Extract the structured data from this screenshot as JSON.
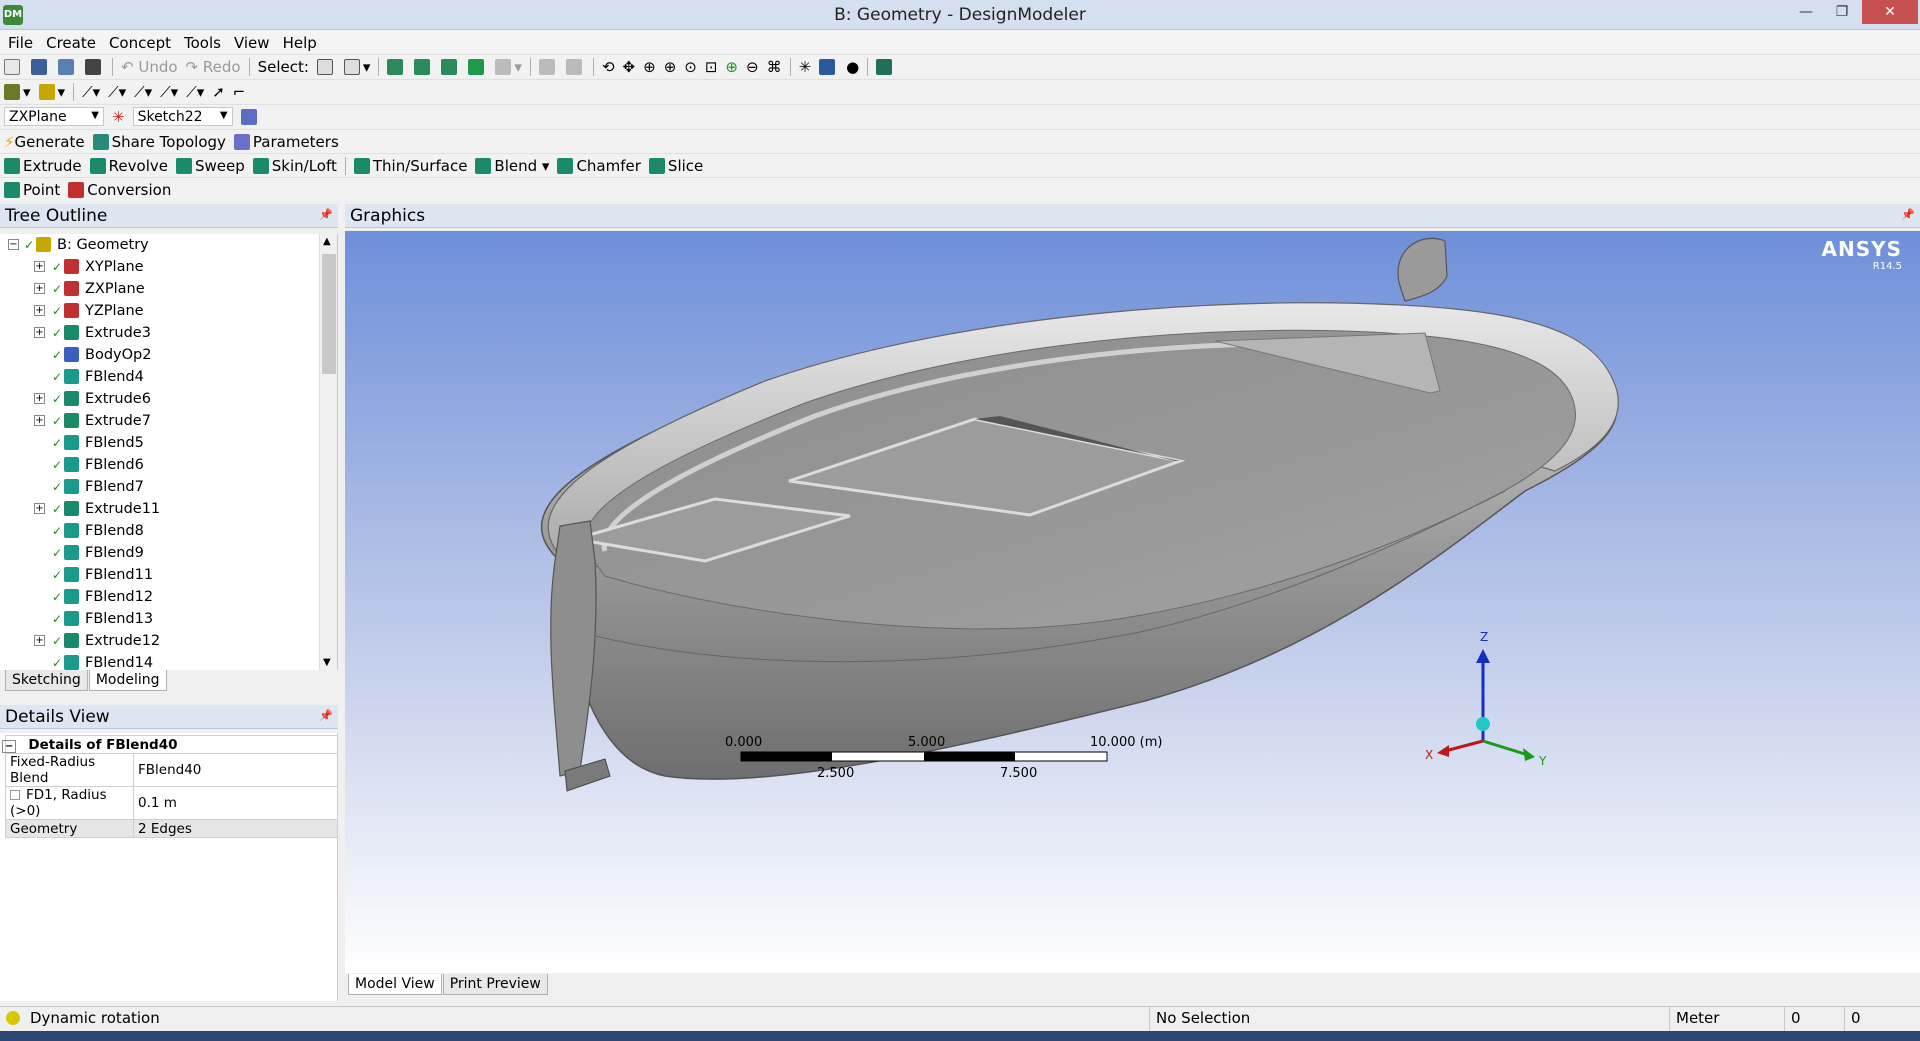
{
  "window": {
    "app_icon": "DM",
    "title": "B: Geometry - DesignModeler",
    "min_glyph": "—",
    "max_glyph": "❐",
    "close_glyph": "✕"
  },
  "menu": [
    "File",
    "Create",
    "Concept",
    "Tools",
    "View",
    "Help"
  ],
  "toolbar1": {
    "undo": "Undo",
    "redo": "Redo",
    "select_label": "Select:"
  },
  "toolbar3": {
    "plane_value": "ZXPlane",
    "sketch_value": "Sketch22"
  },
  "toolbar4": {
    "generate": "Generate",
    "share_topology": "Share Topology",
    "parameters": "Parameters"
  },
  "toolbar5": {
    "extrude": "Extrude",
    "revolve": "Revolve",
    "sweep": "Sweep",
    "skin_loft": "Skin/Loft",
    "thin_surface": "Thin/Surface",
    "blend": "Blend",
    "chamfer": "Chamfer",
    "slice": "Slice"
  },
  "toolbar6": {
    "point": "Point",
    "conversion": "Conversion"
  },
  "tree_outline": {
    "title": "Tree Outline",
    "root": "B: Geometry",
    "items": [
      {
        "label": "XYPlane",
        "icon": "plane-icon",
        "expandable": true
      },
      {
        "label": "ZXPlane",
        "icon": "plane-icon",
        "expandable": true
      },
      {
        "label": "YZPlane",
        "icon": "plane-icon",
        "expandable": true
      },
      {
        "label": "Extrude3",
        "icon": "extrude-icon",
        "expandable": true
      },
      {
        "label": "BodyOp2",
        "icon": "bodyop-icon",
        "expandable": false
      },
      {
        "label": "FBlend4",
        "icon": "blend-icon",
        "expandable": false
      },
      {
        "label": "Extrude6",
        "icon": "extrude-icon",
        "expandable": true
      },
      {
        "label": "Extrude7",
        "icon": "extrude-icon",
        "expandable": true
      },
      {
        "label": "FBlend5",
        "icon": "blend-icon",
        "expandable": false
      },
      {
        "label": "FBlend6",
        "icon": "blend-icon",
        "expandable": false
      },
      {
        "label": "FBlend7",
        "icon": "blend-icon",
        "expandable": false
      },
      {
        "label": "Extrude11",
        "icon": "extrude-icon",
        "expandable": true
      },
      {
        "label": "FBlend8",
        "icon": "blend-icon",
        "expandable": false
      },
      {
        "label": "FBlend9",
        "icon": "blend-icon",
        "expandable": false
      },
      {
        "label": "FBlend11",
        "icon": "blend-icon",
        "expandable": false
      },
      {
        "label": "FBlend12",
        "icon": "blend-icon",
        "expandable": false
      },
      {
        "label": "FBlend13",
        "icon": "blend-icon",
        "expandable": false
      },
      {
        "label": "Extrude12",
        "icon": "extrude-icon",
        "expandable": true
      },
      {
        "label": "FBlend14",
        "icon": "blend-icon",
        "expandable": false
      }
    ],
    "tabs": [
      "Sketching",
      "Modeling"
    ],
    "active_tab": "Modeling"
  },
  "details_view": {
    "title": "Details View",
    "header": "Details of FBlend40",
    "rows": [
      {
        "name": "Fixed-Radius Blend",
        "value": "FBlend40"
      },
      {
        "name": "FD1, Radius (>0)",
        "value": "0.1 m"
      },
      {
        "name": "Geometry",
        "value": "2 Edges"
      }
    ]
  },
  "graphics": {
    "title": "Graphics",
    "brand": "ANSYS",
    "version": "R14.5",
    "scale": {
      "top_labels": [
        "0.000",
        "5.000",
        "10.000 (m)"
      ],
      "bottom_labels": [
        "2.500",
        "7.500"
      ]
    },
    "axis_labels": {
      "x": "X",
      "y": "Y",
      "z": "Z"
    },
    "tabs": [
      "Model View",
      "Print Preview"
    ],
    "active_tab": "Model View"
  },
  "status": {
    "message": "Dynamic rotation",
    "selection": "No Selection",
    "unit": "Meter",
    "field1": "0",
    "field2": "0"
  },
  "colors": {
    "panel_header": "#dde6f1",
    "viewport_top": "#6e8fda",
    "viewport_bottom": "#ffffff",
    "boat_gray": "#8c8c8c",
    "close_red": "#c75050"
  }
}
